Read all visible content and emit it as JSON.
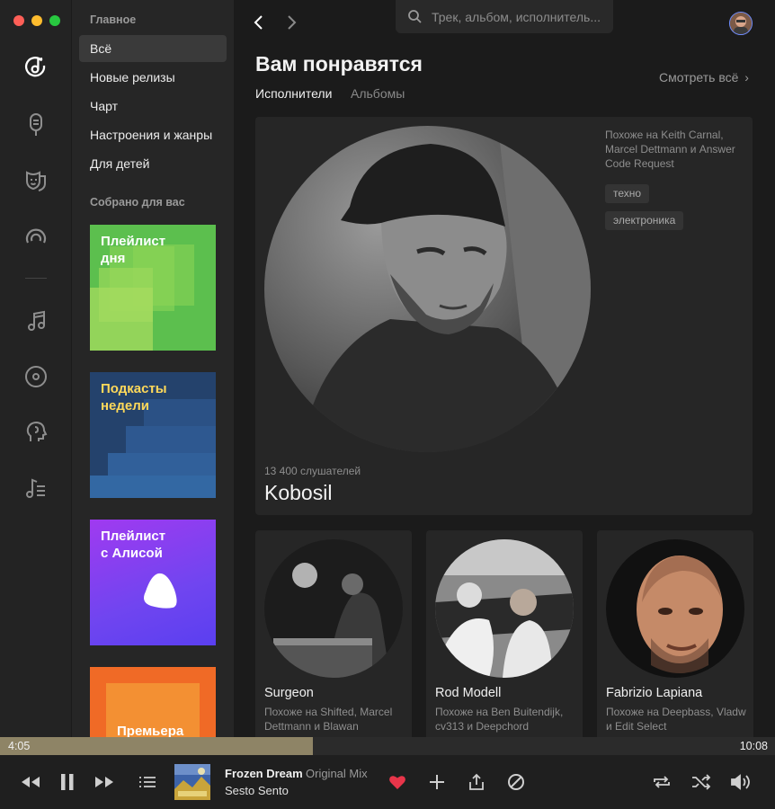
{
  "sidebar": {
    "main_heading": "Главное",
    "items": [
      {
        "label": "Всё",
        "active": true
      },
      {
        "label": "Новые релизы"
      },
      {
        "label": "Чарт"
      },
      {
        "label": "Настроения и жанры"
      },
      {
        "label": "Для детей"
      }
    ],
    "collected_heading": "Собрано для вас",
    "tiles": [
      {
        "label": "Плейлист\nдня",
        "label_color": "#ffffff"
      },
      {
        "label": "Подкасты\nнедели",
        "label_color": "#ffd95a"
      },
      {
        "label": "Плейлист\nс Алисой",
        "label_color": "#ffffff"
      },
      {
        "label": "Премьера",
        "label_color": "#ffffff"
      }
    ]
  },
  "rail_icons": [
    "music-note-icon",
    "microphone-icon",
    "theater-mask-icon",
    "podcast-icon",
    "music-notes-icon",
    "vinyl-disc-icon",
    "artist-head-icon",
    "playlist-icon"
  ],
  "search": {
    "placeholder": "Трек, альбом, исполнитель..."
  },
  "main": {
    "title": "Вам понравятся",
    "see_all": "Смотреть всё",
    "tabs": [
      {
        "label": "Исполнители",
        "active": true
      },
      {
        "label": "Альбомы",
        "active": false
      }
    ],
    "featured": {
      "similar": "Похоже на Keith Carnal, Marcel Dettmann и Answer Code Request",
      "tags": [
        "техно",
        "электроника"
      ],
      "listeners": "13 400 слушателей",
      "name": "Kobosil"
    },
    "cards": [
      {
        "name": "Surgeon",
        "similar": "Похоже на Shifted, Marcel Dettmann и Blawan"
      },
      {
        "name": "Rod Modell",
        "similar": "Похоже на Ben Buitendijk, cv313 и Deepchord"
      },
      {
        "name": "Fabrizio Lapiana",
        "similar": "Похоже на Deepbass, Vladw и Edit Select"
      }
    ]
  },
  "player": {
    "current_time": "4:05",
    "total_time": "10:08",
    "progress_fraction": 0.404,
    "track": "Frozen Dream",
    "version": "Original Mix",
    "artist": "Sesto Sento",
    "liked": true
  },
  "colors": {
    "accent_like": "#e8354a",
    "progress_fill": "#8e8466",
    "avatar_ring": "#6f8dff"
  }
}
